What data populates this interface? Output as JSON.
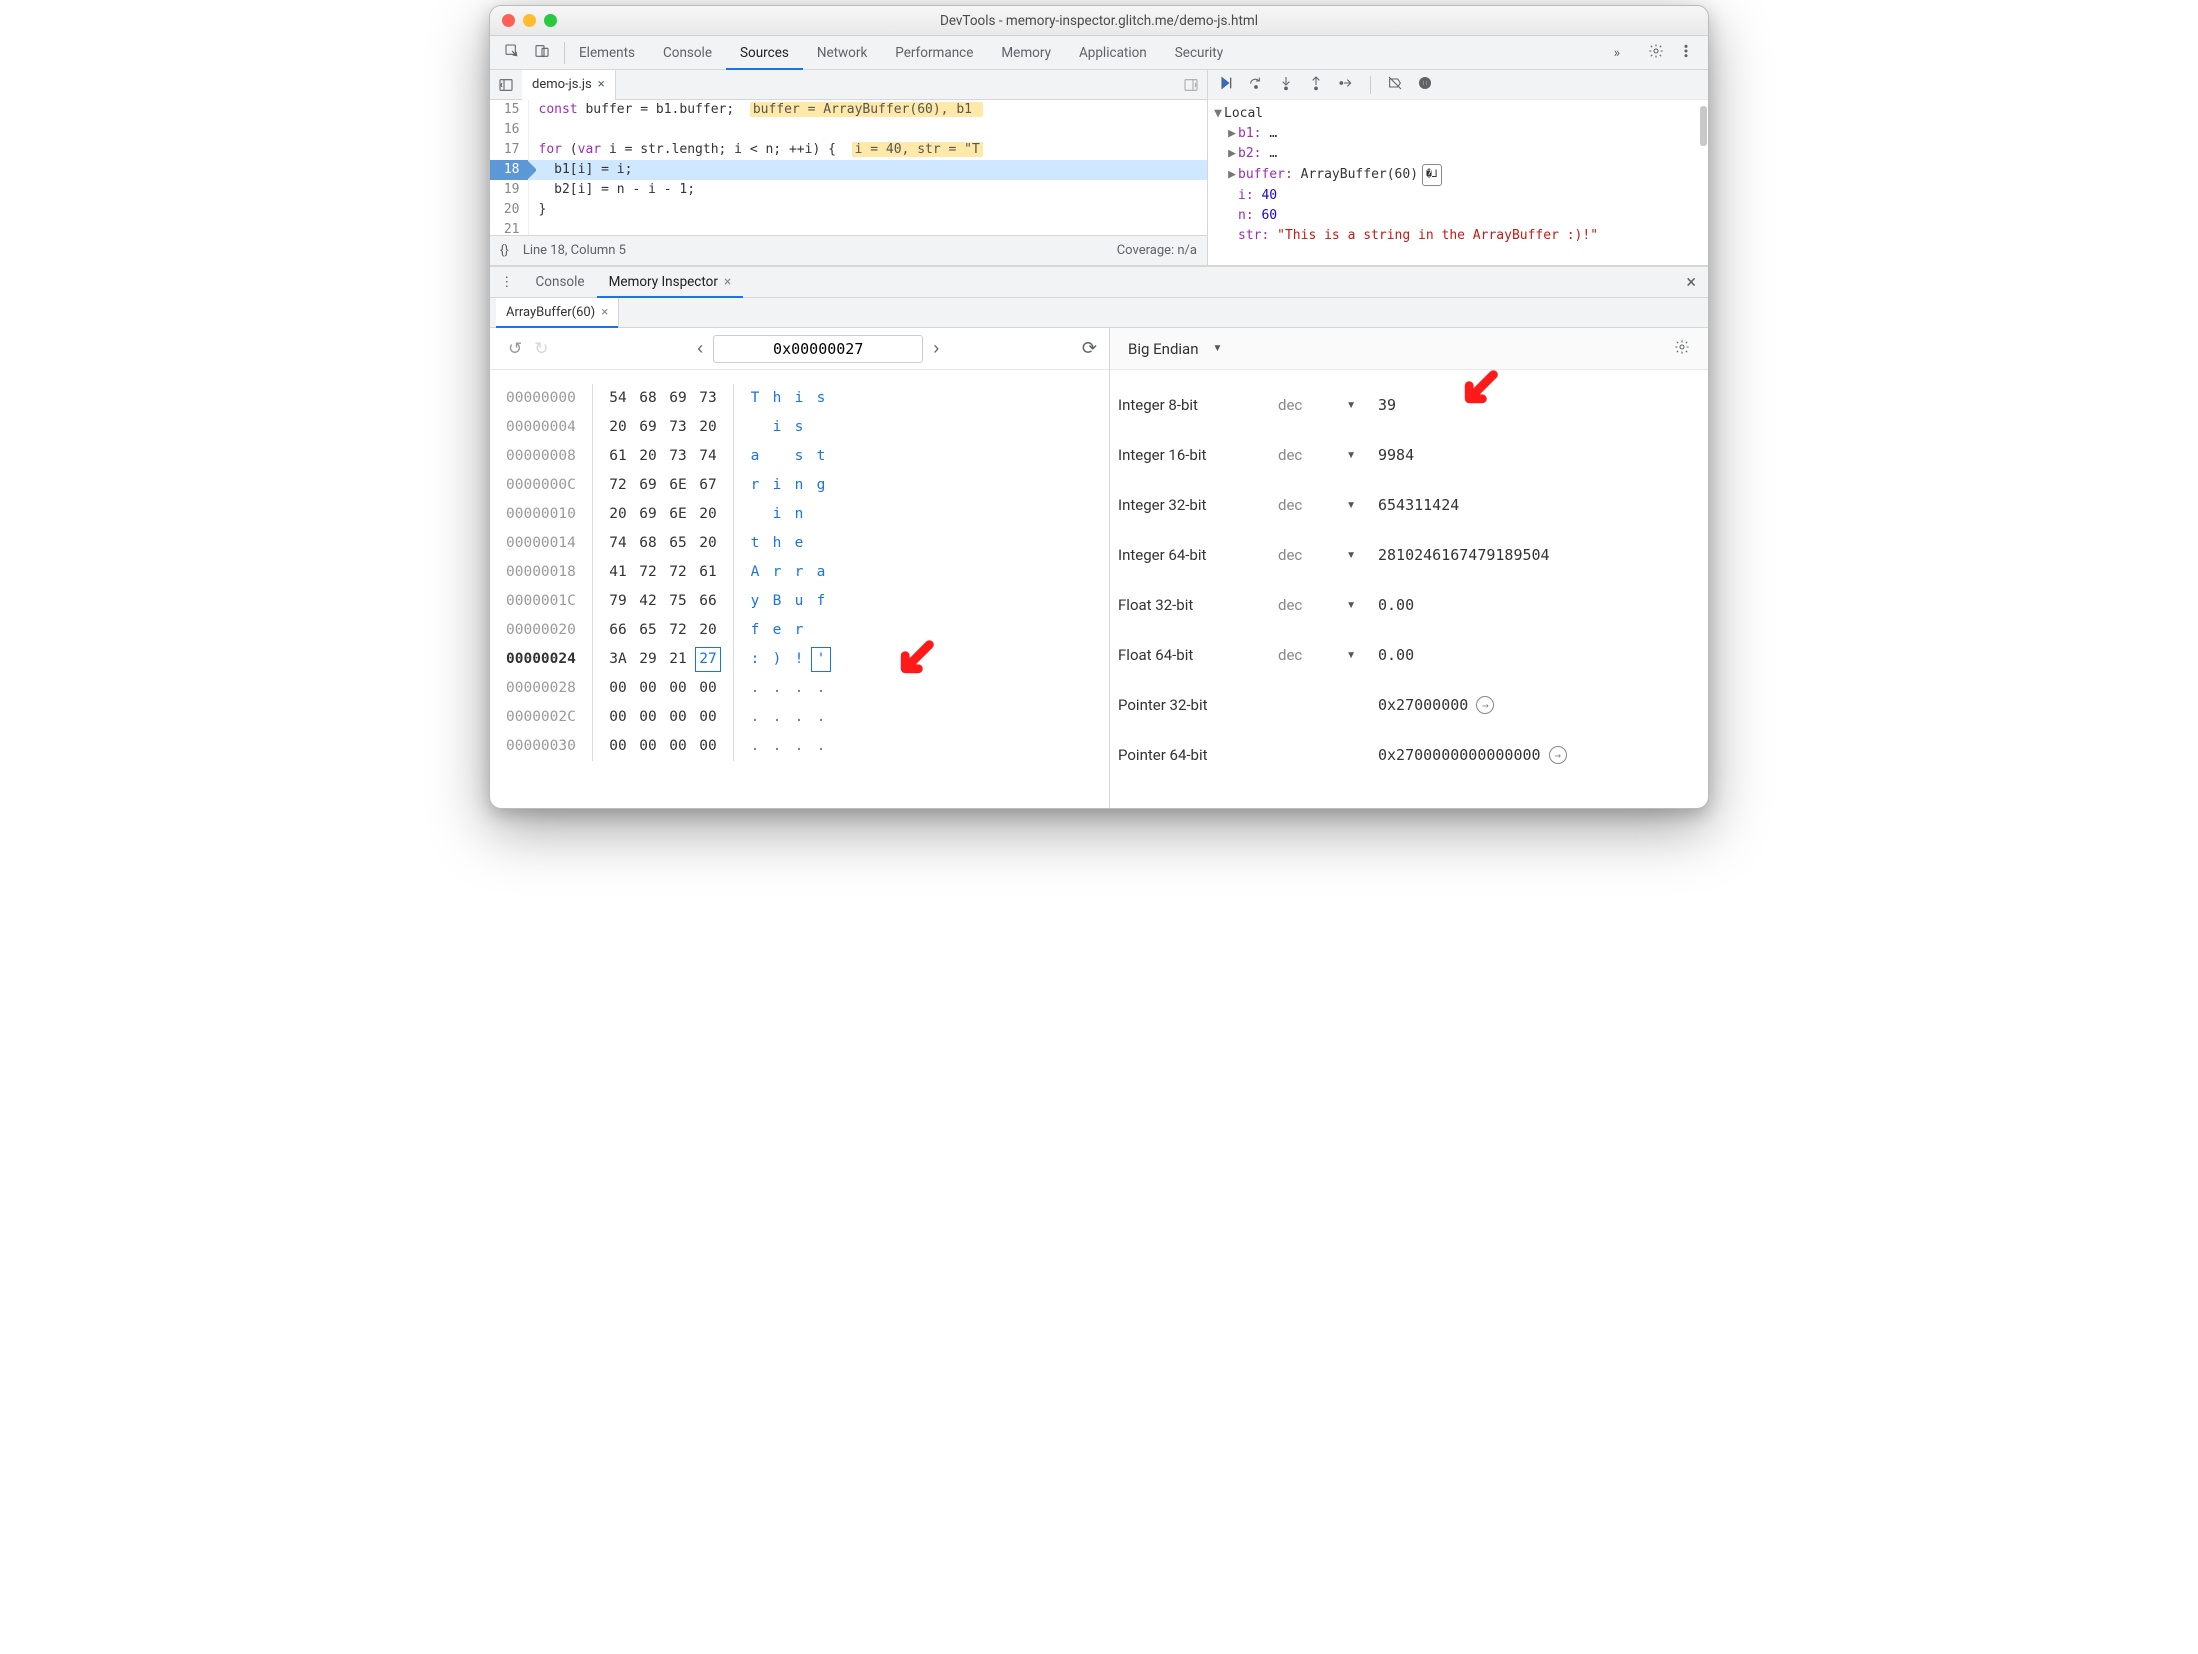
{
  "window": {
    "title": "DevTools - memory-inspector.glitch.me/demo-js.html"
  },
  "mainTabs": {
    "items": [
      "Elements",
      "Console",
      "Sources",
      "Network",
      "Performance",
      "Memory",
      "Application",
      "Security"
    ],
    "active": "Sources",
    "more": "»"
  },
  "editor": {
    "fileTab": "demo-js.js",
    "close": "×",
    "lines": {
      "15": {
        "num": "15",
        "code": "const buffer = b1.buffer;",
        "hint": "buffer = ArrayBuffer(60), b1 "
      },
      "16": {
        "num": "16",
        "code": ""
      },
      "17": {
        "num": "17",
        "pre": "for (var i = str.length; i < n; ++i) {",
        "hint": "i = 40, str = \"T"
      },
      "18": {
        "num": "18",
        "code": "  b1[i] = i;"
      },
      "19": {
        "num": "19",
        "code": "  b2[i] = n - i - 1;"
      },
      "20": {
        "num": "20",
        "code": "}"
      },
      "21": {
        "num": "21",
        "code": ""
      }
    },
    "status": {
      "braces": "{}",
      "pos": "Line 18, Column 5",
      "coverage": "Coverage: n/a"
    }
  },
  "scope": {
    "header": "Local",
    "b1": {
      "name": "b1:",
      "val": "…"
    },
    "b2": {
      "name": "b2:",
      "val": "…"
    },
    "buffer": {
      "name": "buffer:",
      "val": "ArrayBuffer(60)"
    },
    "i": {
      "name": "i:",
      "val": "40"
    },
    "n": {
      "name": "n:",
      "val": "60"
    },
    "str": {
      "name": "str:",
      "val": "\"This is a string in the ArrayBuffer :)!\""
    }
  },
  "drawer": {
    "menu": "⋮",
    "tabs": {
      "console": "Console",
      "mem": "Memory Inspector",
      "close": "×"
    },
    "subTab": "ArrayBuffer(60)",
    "subClose": "×",
    "drawerClose": "×"
  },
  "memNav": {
    "undo": "↺",
    "redo": "↻",
    "prev": "‹",
    "next": "›",
    "address": "0x00000027",
    "refresh": "⟳"
  },
  "hex": {
    "rows": [
      {
        "addr": "00000000",
        "bytes": [
          "54",
          "68",
          "69",
          "73"
        ],
        "asc": [
          "T",
          "h",
          "i",
          "s"
        ]
      },
      {
        "addr": "00000004",
        "bytes": [
          "20",
          "69",
          "73",
          "20"
        ],
        "asc": [
          " ",
          "i",
          "s",
          " "
        ]
      },
      {
        "addr": "00000008",
        "bytes": [
          "61",
          "20",
          "73",
          "74"
        ],
        "asc": [
          "a",
          " ",
          "s",
          "t"
        ]
      },
      {
        "addr": "0000000C",
        "bytes": [
          "72",
          "69",
          "6E",
          "67"
        ],
        "asc": [
          "r",
          "i",
          "n",
          "g"
        ]
      },
      {
        "addr": "00000010",
        "bytes": [
          "20",
          "69",
          "6E",
          "20"
        ],
        "asc": [
          " ",
          "i",
          "n",
          " "
        ]
      },
      {
        "addr": "00000014",
        "bytes": [
          "74",
          "68",
          "65",
          "20"
        ],
        "asc": [
          "t",
          "h",
          "e",
          " "
        ]
      },
      {
        "addr": "00000018",
        "bytes": [
          "41",
          "72",
          "72",
          "61"
        ],
        "asc": [
          "A",
          "r",
          "r",
          "a"
        ]
      },
      {
        "addr": "0000001C",
        "bytes": [
          "79",
          "42",
          "75",
          "66"
        ],
        "asc": [
          "y",
          "B",
          "u",
          "f"
        ]
      },
      {
        "addr": "00000020",
        "bytes": [
          "66",
          "65",
          "72",
          "20"
        ],
        "asc": [
          "f",
          "e",
          "r",
          " "
        ]
      },
      {
        "addr": "00000024",
        "bytes": [
          "3A",
          "29",
          "21",
          "27"
        ],
        "asc": [
          ":",
          ")",
          "!",
          "'"
        ],
        "strong": true,
        "sel": 3
      },
      {
        "addr": "00000028",
        "bytes": [
          "00",
          "00",
          "00",
          "00"
        ],
        "asc": [
          ".",
          ".",
          ".",
          "."
        ],
        "dim": true
      },
      {
        "addr": "0000002C",
        "bytes": [
          "00",
          "00",
          "00",
          "00"
        ],
        "asc": [
          ".",
          ".",
          ".",
          "."
        ],
        "dim": true
      },
      {
        "addr": "00000030",
        "bytes": [
          "00",
          "00",
          "00",
          "00"
        ],
        "asc": [
          ".",
          ".",
          ".",
          "."
        ],
        "dim": true
      }
    ]
  },
  "endian": {
    "label": "Big Endian"
  },
  "values": {
    "int8": {
      "name": "Integer 8-bit",
      "fmt": "dec",
      "val": "39"
    },
    "int16": {
      "name": "Integer 16-bit",
      "fmt": "dec",
      "val": "9984"
    },
    "int32": {
      "name": "Integer 32-bit",
      "fmt": "dec",
      "val": "654311424"
    },
    "int64": {
      "name": "Integer 64-bit",
      "fmt": "dec",
      "val": "2810246167479189504"
    },
    "f32": {
      "name": "Float 32-bit",
      "fmt": "dec",
      "val": "0.00"
    },
    "f64": {
      "name": "Float 64-bit",
      "fmt": "dec",
      "val": "0.00"
    },
    "p32": {
      "name": "Pointer 32-bit",
      "val": "0x27000000"
    },
    "p64": {
      "name": "Pointer 64-bit",
      "val": "0x2700000000000000"
    }
  }
}
